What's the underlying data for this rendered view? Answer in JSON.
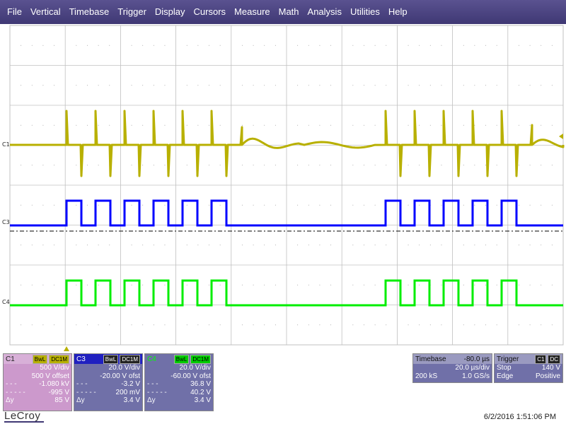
{
  "menu": [
    "File",
    "Vertical",
    "Timebase",
    "Trigger",
    "Display",
    "Cursors",
    "Measure",
    "Math",
    "Analysis",
    "Utilities",
    "Help"
  ],
  "colors": {
    "c1": "#b8b000",
    "c3": "#0000ff",
    "c4": "#00ee00",
    "grid": "#c0c0c0",
    "accent": "#3f3874"
  },
  "trace_labels": {
    "c1": "C1",
    "c3": "C3",
    "c4": "C4"
  },
  "channels": {
    "c1": {
      "name": "C1",
      "flag1": "BwL",
      "flag2": "DC1M",
      "rows": [
        [
          "",
          "500 V/div"
        ],
        [
          "",
          "500 V offset"
        ],
        [
          "- - -",
          "-1.080 kV"
        ],
        [
          "- - - - -",
          "-995 V"
        ],
        [
          "Δy",
          "85 V"
        ]
      ]
    },
    "c3": {
      "name": "C3",
      "flag1": "BwL",
      "flag2": "DC1M",
      "rows": [
        [
          "",
          "20.0 V/div"
        ],
        [
          "",
          "-20.00 V ofst"
        ],
        [
          "- - -",
          "-3.2 V"
        ],
        [
          "- - - - -",
          "200 mV"
        ],
        [
          "Δy",
          "3.4 V"
        ]
      ]
    },
    "c4": {
      "name": "C4",
      "flag1": "BwL",
      "flag2": "DC1M",
      "rows": [
        [
          "",
          "20.0 V/div"
        ],
        [
          "",
          "-60.00 V ofst"
        ],
        [
          "- - -",
          "36.8 V"
        ],
        [
          "- - - - -",
          "40.2 V"
        ],
        [
          "Δy",
          "3.4 V"
        ]
      ]
    }
  },
  "timebase": {
    "label": "Timebase",
    "delay": "-80.0 µs",
    "rate": "20.0 µs/div",
    "samples": "200 kS",
    "sample_rate": "1.0 GS/s"
  },
  "trigger": {
    "label": "Trigger",
    "source": "C1",
    "coupling": "DC",
    "mode": "Stop",
    "level": "140 V",
    "type": "Edge",
    "slope": "Positive"
  },
  "brand": "LeCroy",
  "datetime": "6/2/2016 1:51:06 PM"
}
